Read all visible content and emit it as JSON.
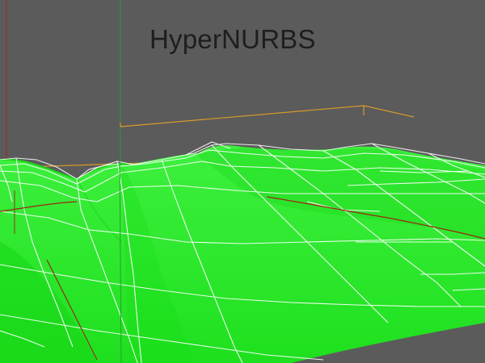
{
  "viewport": {
    "title": "HyperNURBS",
    "background_color": "#5b5b5b",
    "surface_color": "#22ee22",
    "cage_color": "#ffffff",
    "bounding_box_color": "#e0a030",
    "axis_y_color": "#3aa03a",
    "axis_x_color": "#b02020",
    "axis_z_color": "#8a3a1a"
  }
}
